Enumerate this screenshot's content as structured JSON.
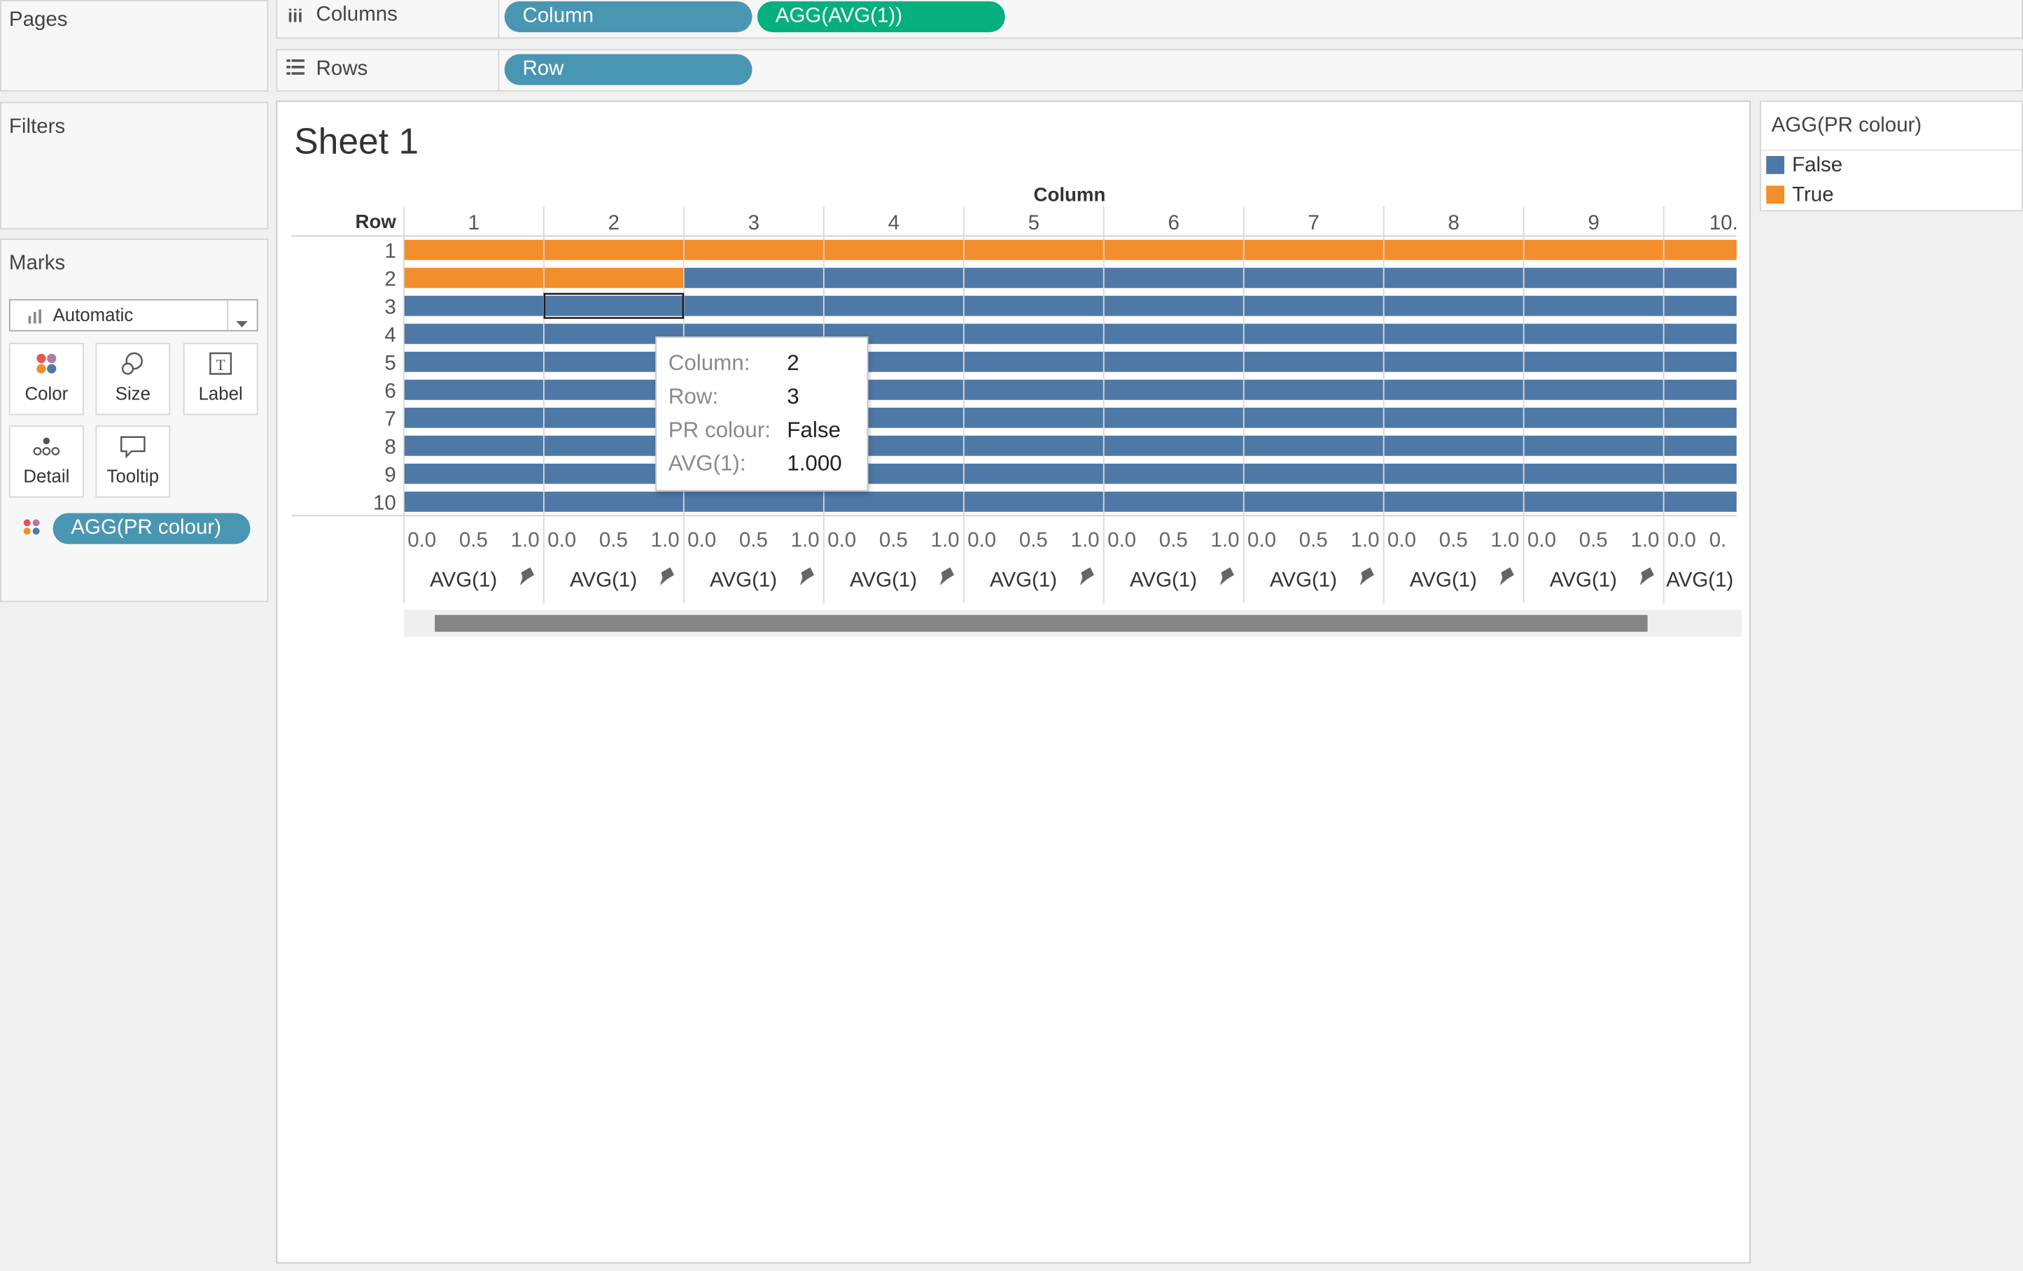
{
  "shelves": {
    "pages_label": "Pages",
    "columns_label": "Columns",
    "rows_label": "Rows",
    "column_pills": [
      "Column",
      "AGG(AVG(1))"
    ],
    "row_pills": [
      "Row"
    ]
  },
  "filters_label": "Filters",
  "marks": {
    "title": "Marks",
    "mark_type": "Automatic",
    "cards": [
      "Color",
      "Size",
      "Label",
      "Detail",
      "Tooltip"
    ],
    "color_pill": "AGG(PR colour)"
  },
  "sheet_title": "Sheet 1",
  "legend": {
    "title": "AGG(PR colour)",
    "items": [
      {
        "label": "False",
        "color": "#4e79a7"
      },
      {
        "label": "True",
        "color": "#f28e2b"
      }
    ]
  },
  "tooltip": {
    "rows": [
      {
        "key": "Column:",
        "value": "2"
      },
      {
        "key": "Row:",
        "value": "3"
      },
      {
        "key": "PR colour:",
        "value": "False"
      },
      {
        "key": "AVG(1):",
        "value": "1.000"
      }
    ]
  },
  "chart_data": {
    "type": "bar",
    "orientation": "horizontal",
    "column_header": "Column",
    "row_header": "Row",
    "columns": [
      "1",
      "2",
      "3",
      "4",
      "5",
      "6",
      "7",
      "8",
      "9",
      "10"
    ],
    "rows": [
      "1",
      "2",
      "3",
      "4",
      "5",
      "6",
      "7",
      "8",
      "9",
      "10"
    ],
    "measure": "AVG(1)",
    "value": 1.0,
    "axis_ticks": [
      "0.0",
      "0.5",
      "1.0"
    ],
    "axis_last_visible_ticks": [
      "0.0",
      "0."
    ],
    "last_column_partial_tick": "10.",
    "xlim": [
      0,
      1
    ],
    "colors": {
      "False": "#4e79a7",
      "True": "#f28e2b"
    },
    "true_cells": [
      [
        1,
        1
      ],
      [
        1,
        2
      ],
      [
        1,
        3
      ],
      [
        1,
        4
      ],
      [
        1,
        5
      ],
      [
        1,
        6
      ],
      [
        1,
        7
      ],
      [
        1,
        8
      ],
      [
        1,
        9
      ],
      [
        1,
        10
      ],
      [
        2,
        1
      ],
      [
        2,
        2
      ]
    ],
    "selected_cell": [
      3,
      2
    ]
  }
}
